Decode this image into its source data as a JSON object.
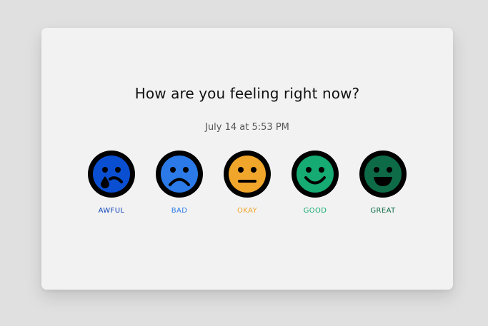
{
  "prompt": {
    "title": "How are you feeling right now?",
    "timestamp": "July 14 at 5:53 PM"
  },
  "moods": [
    {
      "label": "AWFUL",
      "icon": "crying-face-icon",
      "color": "#0a4fd1",
      "label_color": "#1145b8"
    },
    {
      "label": "BAD",
      "icon": "sad-face-icon",
      "color": "#2b7ae8",
      "label_color": "#2b7ae8"
    },
    {
      "label": "OKAY",
      "icon": "neutral-face-icon",
      "color": "#f0a52b",
      "label_color": "#f0a52b"
    },
    {
      "label": "GOOD",
      "icon": "smiling-face-icon",
      "color": "#15ab72",
      "label_color": "#15ab72"
    },
    {
      "label": "GREAT",
      "icon": "grinning-face-icon",
      "color": "#0e6b48",
      "label_color": "#0e6b48"
    }
  ]
}
